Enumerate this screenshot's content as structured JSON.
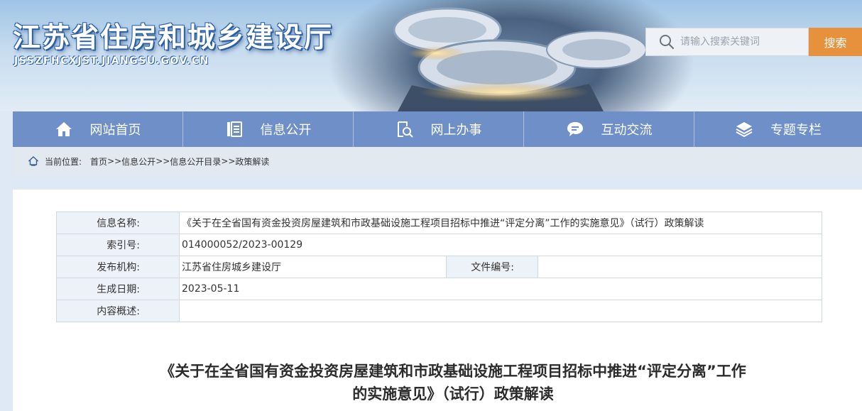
{
  "header": {
    "site_title": "江苏省住房和城乡建设厅",
    "site_url": "JSSZFHCXJST.JIANGSU.GOV.CN",
    "search": {
      "placeholder": "请输入搜索关键词",
      "button_label": "搜索"
    }
  },
  "nav": {
    "items": [
      {
        "label": "网站首页",
        "icon": "home-icon"
      },
      {
        "label": "信息公开",
        "icon": "document-list-icon"
      },
      {
        "label": "网上办事",
        "icon": "search-document-icon"
      },
      {
        "label": "互动交流",
        "icon": "chat-bubble-icon"
      },
      {
        "label": "专题专栏",
        "icon": "layers-icon"
      }
    ]
  },
  "breadcrumb": {
    "label": "当前位置:",
    "items": [
      "首页",
      "信息公开",
      "信息公开目录",
      "政策解读"
    ],
    "separator": ">>"
  },
  "info_table": {
    "name_label": "信息名称:",
    "name_value": "《关于在全省国有资金投资房屋建筑和市政基础设施工程项目招标中推进“评定分离”工作的实施意见》（试行）政策解读",
    "index_label": "索引号:",
    "index_value": "014000052/2023-00129",
    "publisher_label": "发布机构:",
    "publisher_value": "江苏省住房城乡建设厅",
    "doc_number_label": "文件编号:",
    "doc_number_value": "",
    "date_label": "生成日期:",
    "date_value": "2023-05-11",
    "summary_label": "内容概述:",
    "summary_value": ""
  },
  "article": {
    "title_line1": "《关于在全省国有资金投资房屋建筑和市政基础设施工程项目招标中推进“评定分离”工作",
    "title_line2": "的实施意见》（试行）政策解读"
  },
  "colors": {
    "nav_bg": "#6f8fc8",
    "search_button": "#e8913d",
    "title_blue": "#2a5fa6"
  }
}
